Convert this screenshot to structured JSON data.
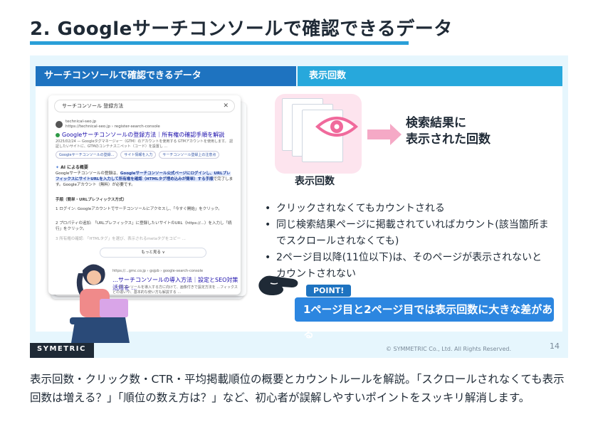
{
  "page_title": "2. Googleサーチコンソールで確認できるデータ",
  "slide": {
    "header_left": "サーチコンソールで確認できるデータ",
    "header_right": "表示回数",
    "search_card": {
      "query": "サーチコンソール 登録方法",
      "site_name": "technical-seo.jp",
      "site_url": "https://technical-seo.jp › register-search-console",
      "result_title": "Googleサーチコンソールの登録方法｜所有権の確認手順を解説",
      "snippet": "2025/02/24 — Googleタグマネージャー（GTM）のアカウントを使用する GTMアカウントを使用します。 認証したいサイトに、GTMのコンテナスニペット（コード）を設置し ...",
      "chips": [
        "Googleサーチコンソールの登録...",
        "サイト情報を入力",
        "サーチコンソール登録上の注意点"
      ],
      "ai_label": "AI による概要",
      "ai_text_prefix": "Googleサーチコンソールの登録は、",
      "ai_text_highlight": "Googleサーチコンソール公式ページにログインし、URLプレフィックスにサイトURLを入力して所有権を確認（HTMLタグ埋め込みが簡単）する手順",
      "ai_text_suffix": "で完了します。Googleアカウント（無料）が必要です。",
      "steps_heading": "手順（簡単・URLプレフィックス方式）",
      "step1": "1 ログイン: Googleアカウントでサーチコンソールにアクセスし、「今すぐ開始」をクリック。",
      "step2": "2 プロパティの追加: 「URLプレフィックス」に登録したいサイトのURL（https://...）を入力し「続行」をクリック。",
      "step3": "3 所有権の確認: 「HTMLタグ」を選び、表示されるmetaタグをコピー ...",
      "more_label": "もっと見る ∨",
      "result2_url": "https://...gmc.co.jp › gsjpb › google-search-console",
      "result2_title": "…サーチコンソールの導入方法｜設定とSEO対策活用を ...",
      "result2_snippet": "…ーチコンソールを導入する方に向けて、画像付きで設定方法を ...フィックスとの違いや、基本的な使い方も解説する ..."
    },
    "impression_label": "表示回数",
    "result_label_line1": "検索結果に",
    "result_label_line2": "表示された回数",
    "bullets": [
      "クリックされなくてもカウントされる",
      "同じ検索結果ページに掲載されていればカウント(該当箇所までスクロールされなくても)",
      "2ページ目以降(11位以下)は、そのページが表示されないとカウントされない"
    ],
    "point_tag": "POINT!",
    "point_text": "1ページ目と2ページ目では表示回数に大きな差がある",
    "brand": "SYMETRIC",
    "copyright": "© SYMMETRIC Co., Ltd. All Rights Reserved.",
    "page_number": "14"
  },
  "description": "表示回数・クリック数・CTR・平均掲載順位の概要とカウントルールを解説。「スクロールされなくても表示回数は増える？」「順位の数え方は？」など、初心者が誤解しやすいポイントをスッキリ解消します。",
  "colors": {
    "accent_blue": "#2a9fd8",
    "header_dark_blue": "#1e73c0",
    "header_light_blue": "#27a8dc",
    "slide_bg": "#e6f6fd",
    "pink": "#f06a9c",
    "point_box": "#2c86e0"
  }
}
